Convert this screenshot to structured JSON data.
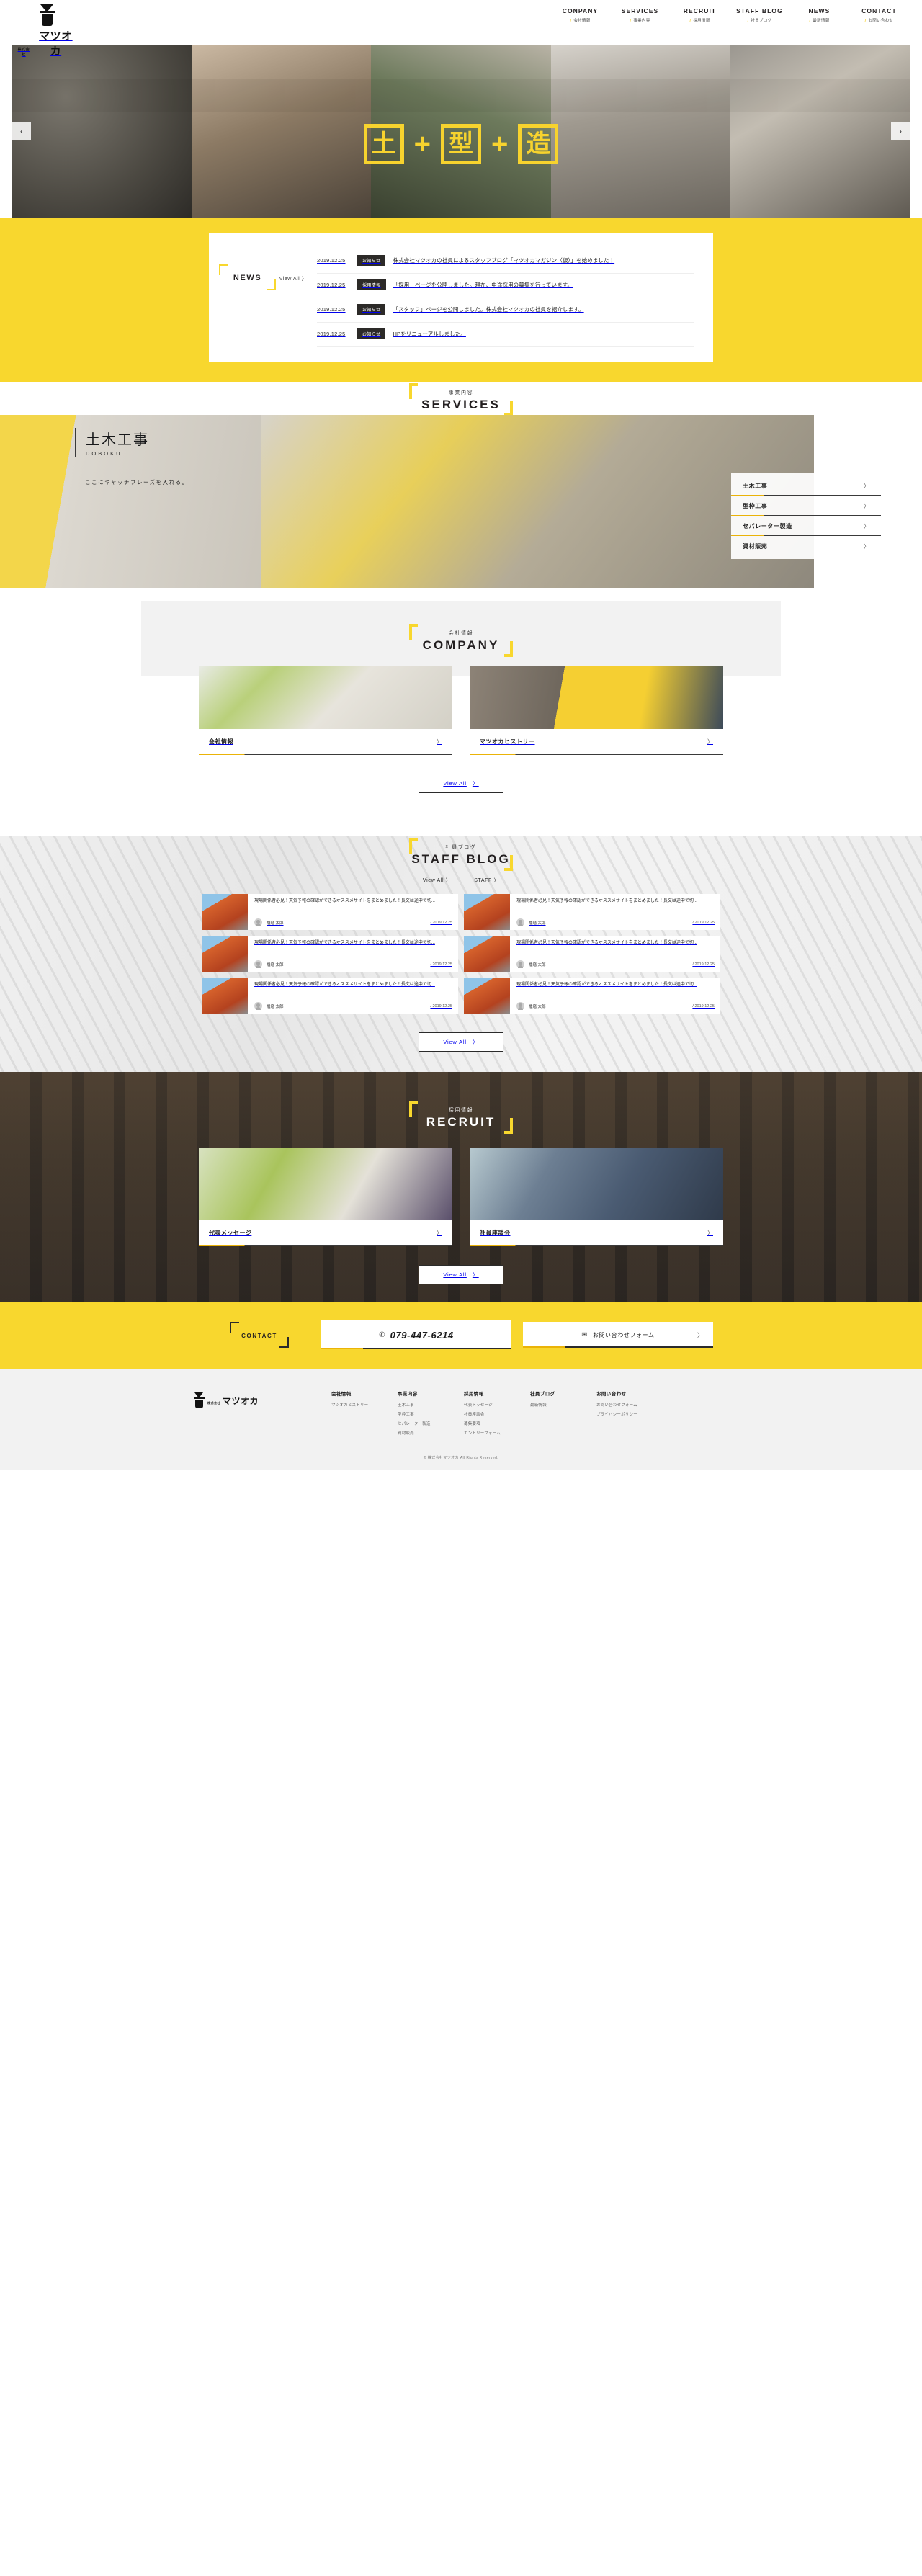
{
  "site": {
    "company_kk": "株式会社",
    "company_name": "マツオカ"
  },
  "nav": [
    {
      "en": "CONPANY",
      "jp": "会社情報"
    },
    {
      "en": "SERVICES",
      "jp": "事業内容"
    },
    {
      "en": "RECRUIT",
      "jp": "採用情報"
    },
    {
      "en": "STAFF BLOG",
      "jp": "社員ブログ"
    },
    {
      "en": "NEWS",
      "jp": "最新情報"
    },
    {
      "en": "CONTACT",
      "jp": "お問い合わせ"
    }
  ],
  "hero": {
    "kanji": [
      "土",
      "型",
      "造"
    ],
    "plus": "+",
    "prev": "‹",
    "next": "›"
  },
  "news": {
    "title": "NEWS",
    "view_all": "View All 〉",
    "items": [
      {
        "date": "2019.12.25",
        "tag": "お知らせ",
        "text": "株式会社マツオカの社員によるスタッフブログ「マツオカマガジン（仮）」を始めました！"
      },
      {
        "date": "2019.12.25",
        "tag": "採用情報",
        "text": "「採用」ページを公開しました。現在、中途採用の募集を行っています。"
      },
      {
        "date": "2019.12.25",
        "tag": "お知らせ",
        "text": "「スタッフ」ページを公開しました。株式会社マツオカの社員を紹介します。"
      },
      {
        "date": "2019.12.25",
        "tag": "お知らせ",
        "text": "HPをリニューアルしました。"
      }
    ]
  },
  "services": {
    "heading_jp": "事業内容",
    "heading_en": "SERVICES",
    "feature_jp": "土木工事",
    "feature_en": "DOBOKU",
    "feature_catch": "ここにキャッチフレーズを入れる。",
    "menu": [
      {
        "label": "土木工事",
        "chev": "〉"
      },
      {
        "label": "型枠工事",
        "chev": "〉"
      },
      {
        "label": "セパレーター製造",
        "chev": "〉"
      },
      {
        "label": "資材販売",
        "chev": "〉"
      }
    ]
  },
  "company": {
    "heading_jp": "会社情報",
    "heading_en": "COMPANY",
    "cards": [
      {
        "label": "会社情報",
        "chev": "〉"
      },
      {
        "label": "マツオカヒストリー",
        "chev": "〉"
      }
    ],
    "view_all": "View All",
    "view_all_chev": "〉"
  },
  "blog": {
    "heading_jp": "社員ブログ",
    "heading_en": "STAFF BLOG",
    "links": [
      {
        "label": "View All 〉"
      },
      {
        "label": "STAFF 〉"
      }
    ],
    "posts": [
      {
        "title": "現場関係者必見！天気予報の確認ができるオススメサイトをまとめました！長文は途中で切...",
        "author": "播磨 太郎",
        "date": "2019.12.25"
      },
      {
        "title": "現場関係者必見！天気予報の確認ができるオススメサイトをまとめました！長文は途中で切...",
        "author": "播磨 太郎",
        "date": "2019.12.25"
      },
      {
        "title": "現場関係者必見！天気予報の確認ができるオススメサイトをまとめました！長文は途中で切...",
        "author": "播磨 太郎",
        "date": "2019.12.25"
      },
      {
        "title": "現場関係者必見！天気予報の確認ができるオススメサイトをまとめました！長文は途中で切...",
        "author": "播磨 太郎",
        "date": "2019.12.25"
      },
      {
        "title": "現場関係者必見！天気予報の確認ができるオススメサイトをまとめました！長文は途中で切...",
        "author": "播磨 太郎",
        "date": "2019.12.25"
      },
      {
        "title": "現場関係者必見！天気予報の確認ができるオススメサイトをまとめました！長文は途中で切...",
        "author": "播磨 太郎",
        "date": "2019.12.25"
      }
    ],
    "view_all": "View All",
    "view_all_chev": "〉"
  },
  "recruit": {
    "heading_jp": "採用情報",
    "heading_en": "RECRUIT",
    "cards": [
      {
        "label": "代表メッセージ",
        "chev": "〉"
      },
      {
        "label": "社員座談会",
        "chev": "〉"
      }
    ],
    "view_all": "View All",
    "view_all_chev": "〉"
  },
  "contact": {
    "label": "CONTACT",
    "phone_icon": "phone-icon",
    "phone": "079-447-6214",
    "mail_icon": "mail-icon",
    "form_label": "お問い合わせフォーム",
    "chev": "〉"
  },
  "footer": {
    "columns": [
      {
        "head": "会社情報",
        "links": [
          "マツオカヒストリー"
        ]
      },
      {
        "head": "事業内容",
        "links": [
          "土木工事",
          "型枠工事",
          "セパレーター製造",
          "資材販売"
        ]
      },
      {
        "head": "採用情報",
        "links": [
          "代表メッセージ",
          "社員座談会",
          "募集要項",
          "エントリーフォーム"
        ]
      },
      {
        "head": "社員ブログ",
        "links": [
          "最新情報"
        ]
      },
      {
        "head": "お問い合わせ",
        "links": [
          "お問い合わせフォーム",
          "プライバシーポリシー"
        ]
      }
    ],
    "copyright": "© 株式会社マツオカ All Rights Reserved."
  },
  "colors": {
    "brand_yellow": "#f8d72e",
    "ink": "#231f20",
    "dark": "#2a2724"
  }
}
